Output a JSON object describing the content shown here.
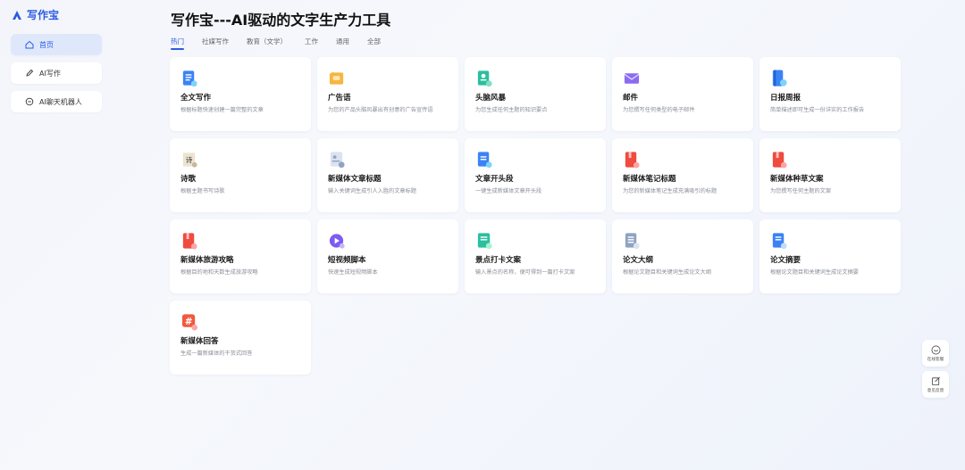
{
  "logo": {
    "text": "写作宝",
    "icon": "logo-icon"
  },
  "sidebar": {
    "items": [
      {
        "label": "首页",
        "icon": "home-icon",
        "active": true
      },
      {
        "label": "AI写作",
        "icon": "pen-icon",
        "active": false
      },
      {
        "label": "AI聊天机器人",
        "icon": "chat-icon",
        "active": false
      }
    ]
  },
  "header": {
    "title": "写作宝---AI驱动的文字生产力工具"
  },
  "tabs": [
    "热门",
    "社媒写作",
    "教育（文学）",
    "工作",
    "通用",
    "全部"
  ],
  "cards": [
    {
      "title": "全文写作",
      "desc": "根据标题快速创建一篇完整的文章",
      "icon": "document-icon",
      "color": "#3b82f6"
    },
    {
      "title": "广告语",
      "desc": "为您的产品头脑风暴出有创意的广告宣传语",
      "icon": "megaphone-icon",
      "color": "#f5b642"
    },
    {
      "title": "头脑风暴",
      "desc": "为您生成任何主题的知识要点",
      "icon": "lightbulb-doc-icon",
      "color": "#2bbf9e"
    },
    {
      "title": "邮件",
      "desc": "为您撰写任何类型的电子邮件",
      "icon": "mail-icon",
      "color": "#8b6cf0"
    },
    {
      "title": "日报周报",
      "desc": "简单描述即可生成一份详实的工作报告",
      "icon": "report-icon",
      "color": "#3b82f6"
    },
    {
      "title": "诗歌",
      "desc": "根据主题书写诗歌",
      "icon": "poem-icon",
      "color": "#c8b89a"
    },
    {
      "title": "新媒体文章标题",
      "desc": "输入关键词生成引人入胜的文章标题",
      "icon": "article-title-icon",
      "color": "#8fa3c2"
    },
    {
      "title": "文章开头段",
      "desc": "一键生成新媒体文章开头段",
      "icon": "paragraph-icon",
      "color": "#3b82f6"
    },
    {
      "title": "新媒体笔记标题",
      "desc": "为您的新媒体笔记生成充满吸引的标题",
      "icon": "notebook-icon",
      "color": "#ef4b3f"
    },
    {
      "title": "新媒体种草文案",
      "desc": "为您撰写任何主题的文案",
      "icon": "notebook-icon",
      "color": "#ef4b3f"
    },
    {
      "title": "新媒体旅游攻略",
      "desc": "根据目的地和天数生成旅游攻略",
      "icon": "notebook-icon",
      "color": "#ef4b3f"
    },
    {
      "title": "短视频脚本",
      "desc": "快速生成短视频脚本",
      "icon": "video-icon",
      "color": "#7c5cf0"
    },
    {
      "title": "景点打卡文案",
      "desc": "输入景点的名称，便可得到一篇打卡文案",
      "icon": "checkin-icon",
      "color": "#2bbf9e"
    },
    {
      "title": "论文大纲",
      "desc": "根据论文题目和关键词生成论文大纲",
      "icon": "outline-icon",
      "color": "#8fa3c2"
    },
    {
      "title": "论文摘要",
      "desc": "根据论文题目和关键词生成论文摘要",
      "icon": "abstract-icon",
      "color": "#3b82f6"
    },
    {
      "title": "新媒体回答",
      "desc": "生成一篇新媒体的干货式回答",
      "icon": "hashtag-icon",
      "color": "#ef5a3f"
    }
  ],
  "float_buttons": [
    {
      "label": "在线客服",
      "icon": "customer-service-icon"
    },
    {
      "label": "意见反馈",
      "icon": "feedback-icon"
    }
  ],
  "colors": {
    "accent": "#2c5be0",
    "active_nav_bg": "#dfe8fb"
  }
}
